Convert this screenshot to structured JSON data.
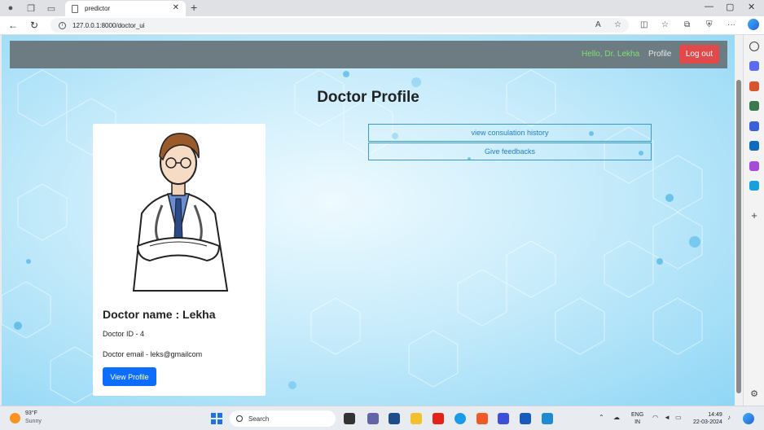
{
  "browser": {
    "tab_title": "predictor",
    "url": "127.0.0.1:8000/doctor_ui",
    "new_tab_label": "+",
    "tab_close_label": "✕",
    "back_label": "←",
    "reload_label": "↻",
    "minimize_label": "—",
    "maximize_label": "▢",
    "close_label": "✕",
    "read_aloud_label": "A",
    "favorite_label": "☆",
    "split_label": "◫",
    "favorites_label": "☆",
    "collections_label": "⧉",
    "extensions_label": "⛨",
    "more_label": "···"
  },
  "navbar": {
    "greeting": "Hello, Dr. Lekha",
    "profile_link": "Profile",
    "logout_label": "Log out"
  },
  "page": {
    "title": "Doctor Profile"
  },
  "card": {
    "name": "Doctor name : Lekha",
    "id": "Doctor ID - 4",
    "email": "Doctor email - leks@gmailcom",
    "view_profile_label": "View Profile"
  },
  "actions": {
    "history_label": "view consulation history",
    "feedback_label": "Give feedbacks"
  },
  "taskbar": {
    "temperature": "93°F",
    "condition": "Sunny",
    "search_placeholder": "Search",
    "lang_top": "ENG",
    "lang_bottom": "IN",
    "time": "14:49",
    "date": "22-03-2024"
  },
  "colors": {
    "navbar_bg": "#6c7c82",
    "greeting": "#7ee06e",
    "logout_bg": "#e2494a",
    "primary": "#0d6efd",
    "outline": "#3a9ad0"
  }
}
